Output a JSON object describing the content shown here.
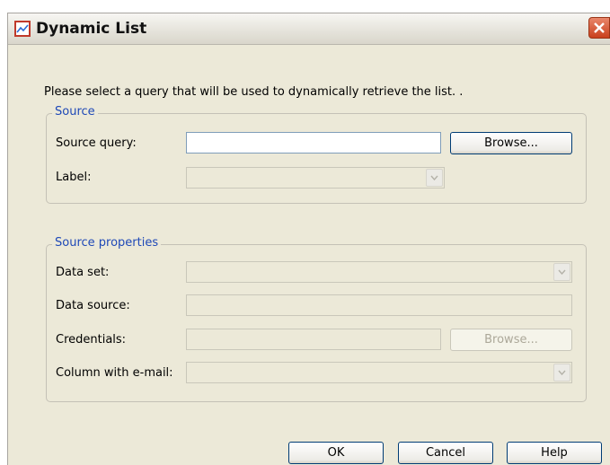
{
  "window": {
    "title": "Dynamic List",
    "app_icon": "chart-window-icon",
    "close_icon": "close-icon"
  },
  "instruction": "Please select a query that will be used to dynamically retrieve the list. .",
  "source": {
    "legend": "Source",
    "source_query_label": "Source query:",
    "source_query_value": "",
    "browse_label": "Browse...",
    "label_label": "Label:",
    "label_value": ""
  },
  "source_properties": {
    "legend": "Source properties",
    "data_set_label": "Data set:",
    "data_set_value": "",
    "data_source_label": "Data source:",
    "data_source_value": "",
    "credentials_label": "Credentials:",
    "credentials_value": "",
    "credentials_browse_label": "Browse...",
    "column_email_label": "Column with e-mail:",
    "column_email_value": ""
  },
  "buttons": {
    "ok": "OK",
    "cancel": "Cancel",
    "help": "Help"
  }
}
